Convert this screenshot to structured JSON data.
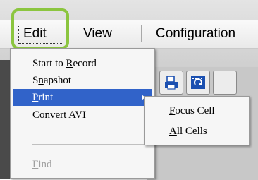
{
  "menubar": {
    "items": [
      {
        "label": "Edit"
      },
      {
        "label": "View"
      },
      {
        "label": "Configuration"
      }
    ]
  },
  "edit_menu": {
    "items": [
      {
        "label": "Start to Record",
        "mnemonic": "R",
        "state": "normal"
      },
      {
        "label": "Snapshot",
        "mnemonic": "n",
        "state": "normal"
      },
      {
        "label": "Print",
        "mnemonic": "P",
        "state": "selected",
        "has_submenu": true
      },
      {
        "label": "Convert AVI",
        "mnemonic": "C",
        "state": "normal"
      },
      {
        "label": "Find",
        "mnemonic": "F",
        "state": "disabled"
      }
    ]
  },
  "print_submenu": {
    "items": [
      {
        "label": "Focus Cell",
        "mnemonic": "F"
      },
      {
        "label": "All Cells",
        "mnemonic": "A"
      }
    ]
  },
  "toolbar": {
    "buttons": [
      {
        "icon": "print-icon"
      },
      {
        "icon": "refresh-film-icon"
      }
    ]
  },
  "colors": {
    "highlight_ring": "#8bc53f",
    "selection": "#3163c9"
  }
}
